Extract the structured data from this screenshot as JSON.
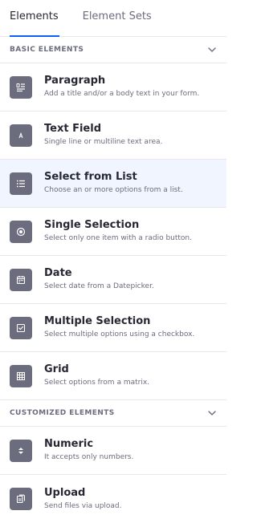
{
  "tabs": [
    {
      "label": "Elements"
    },
    {
      "label": "Element Sets"
    }
  ],
  "sections": {
    "basic": {
      "title": "BASIC ELEMENTS"
    },
    "custom": {
      "title": "CUSTOMIZED ELEMENTS"
    }
  },
  "basic_items": [
    {
      "title": "Paragraph",
      "desc": "Add a title and/or a body text in your form.",
      "icon": "paragraph-icon"
    },
    {
      "title": "Text Field",
      "desc": "Single line or multiline text area.",
      "icon": "text-field-icon"
    },
    {
      "title": "Select from List",
      "desc": "Choose an or more options from a list.",
      "icon": "list-icon"
    },
    {
      "title": "Single Selection",
      "desc": "Select only one item with a radio button.",
      "icon": "radio-icon"
    },
    {
      "title": "Date",
      "desc": "Select date from a Datepicker.",
      "icon": "calendar-icon"
    },
    {
      "title": "Multiple Selection",
      "desc": "Select multiple options using a checkbox.",
      "icon": "checkbox-icon"
    },
    {
      "title": "Grid",
      "desc": "Select options from a matrix.",
      "icon": "grid-icon"
    }
  ],
  "custom_items": [
    {
      "title": "Numeric",
      "desc": "It accepts only numbers.",
      "icon": "numeric-icon"
    },
    {
      "title": "Upload",
      "desc": "Send files via upload.",
      "icon": "upload-icon"
    }
  ],
  "colors": {
    "accent": "#0b5fff",
    "icon_bg": "#6b6c7e",
    "highlight_bg": "#f0f5ff"
  }
}
